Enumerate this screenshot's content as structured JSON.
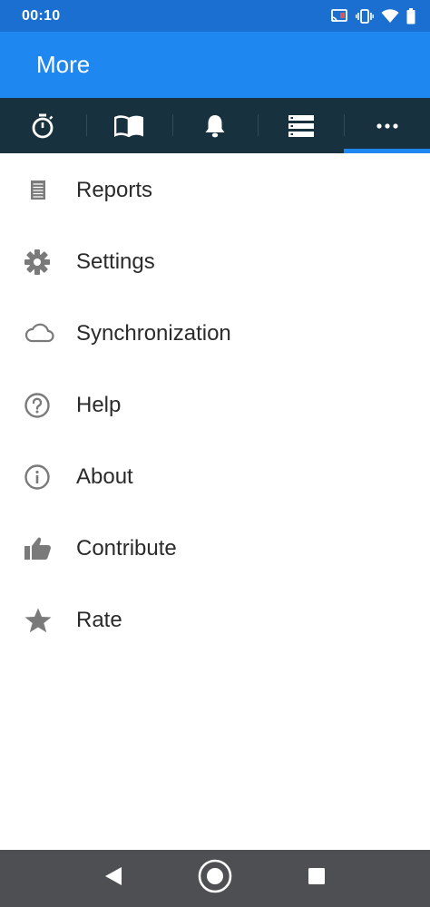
{
  "status_bar": {
    "time": "00:10",
    "icons": [
      "cast-icon",
      "vibrate-icon",
      "wifi-icon",
      "battery-icon"
    ]
  },
  "app_bar": {
    "title": "More"
  },
  "tabs": [
    {
      "name": "stopwatch-icon",
      "active": false
    },
    {
      "name": "book-icon",
      "active": false
    },
    {
      "name": "bell-icon",
      "active": false
    },
    {
      "name": "list-icon",
      "active": false
    },
    {
      "name": "more-horiz-icon",
      "active": true
    }
  ],
  "menu": {
    "items": [
      {
        "label": "Reports",
        "icon": "report-icon"
      },
      {
        "label": "Settings",
        "icon": "gear-icon"
      },
      {
        "label": "Synchronization",
        "icon": "cloud-icon"
      },
      {
        "label": "Help",
        "icon": "help-icon"
      },
      {
        "label": "About",
        "icon": "info-icon"
      },
      {
        "label": "Contribute",
        "icon": "thumbs-up-icon"
      },
      {
        "label": "Rate",
        "icon": "star-icon"
      }
    ]
  },
  "nav_bar": {
    "buttons": [
      "back-icon",
      "home-icon",
      "recents-icon"
    ]
  },
  "colors": {
    "status_bar": "#1a6fd0",
    "app_bar": "#1e88f0",
    "tab_bar": "#18313f",
    "tab_indicator": "#1e88f0",
    "icon_gray": "#7a7a7a",
    "nav_bar": "#4d4f52"
  }
}
